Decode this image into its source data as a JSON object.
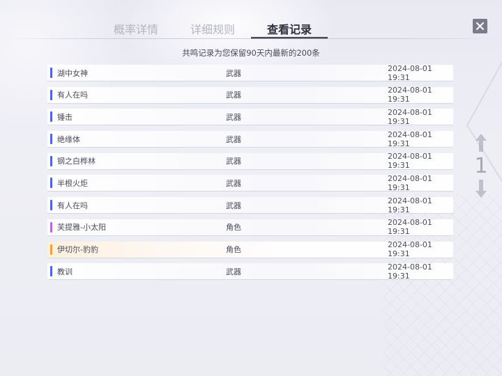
{
  "tabs": [
    {
      "label": "概率详情",
      "active": false
    },
    {
      "label": "详细规则",
      "active": false
    },
    {
      "label": "查看记录",
      "active": true
    }
  ],
  "subtitle": "共鸣记录为您保留90天内最新的200条",
  "records": [
    {
      "name": "湖中女神",
      "type": "武器",
      "time": "2024-08-01 19:31",
      "rarity_color": "#4a63e8"
    },
    {
      "name": "有人在吗",
      "type": "武器",
      "time": "2024-08-01 19:31",
      "rarity_color": "#4a63e8"
    },
    {
      "name": "锤击",
      "type": "武器",
      "time": "2024-08-01 19:31",
      "rarity_color": "#4a63e8"
    },
    {
      "name": "绝缘体",
      "type": "武器",
      "time": "2024-08-01 19:31",
      "rarity_color": "#4a63e8"
    },
    {
      "name": "钢之白桦林",
      "type": "武器",
      "time": "2024-08-01 19:31",
      "rarity_color": "#4a63e8"
    },
    {
      "name": "半根火炬",
      "type": "武器",
      "time": "2024-08-01 19:31",
      "rarity_color": "#4a63e8"
    },
    {
      "name": "有人在吗",
      "type": "武器",
      "time": "2024-08-01 19:31",
      "rarity_color": "#4a63e8"
    },
    {
      "name": "芙提雅-小太阳",
      "type": "角色",
      "time": "2024-08-01 19:31",
      "rarity_color": "#c064d6"
    },
    {
      "name": "伊切尔-豹豹",
      "type": "角色",
      "time": "2024-08-01 19:31",
      "rarity_color": "#f0a040"
    },
    {
      "name": "教训",
      "type": "武器",
      "time": "2024-08-01 19:31",
      "rarity_color": "#4a63e8"
    }
  ],
  "pager": {
    "page": "1"
  },
  "icons": {
    "close": "close-icon",
    "prev": "arrow-up-icon",
    "next": "arrow-down-icon"
  }
}
